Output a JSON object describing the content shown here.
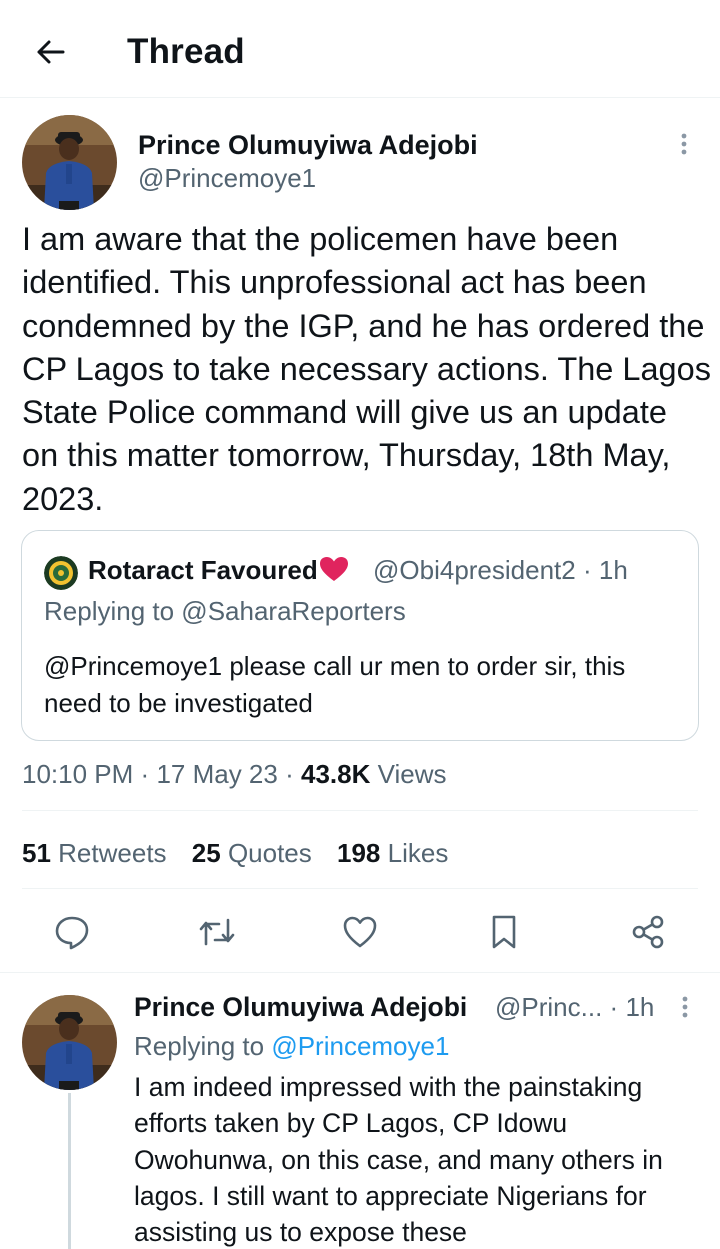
{
  "header": {
    "title": "Thread",
    "back_icon": "arrow-left-icon"
  },
  "main_tweet": {
    "author_name": "Prince Olumuyiwa Adejobi",
    "author_handle": "@Princemoye1",
    "text": "I am aware that the policemen have been identified. This unprofessional act has been condemned by the IGP, and he has ordered the CP Lagos to take necessary actions. The Lagos State Police command will give us an update on this matter tomorrow, Thursday, 18th May, 2023.",
    "quoted": {
      "author_name": "Rotaract Favoured",
      "author_handle": "@Obi4president2",
      "time": "1h",
      "replying_to": "Replying to @SaharaReporters",
      "text": "@Princemoye1 please call ur men to order sir, this need to be investigated"
    },
    "time": "10:10 PM",
    "date": "17 May 23",
    "views_count": "43.8K",
    "views_label": "Views",
    "stats": {
      "retweets_count": "51",
      "retweets_label": "Retweets",
      "quotes_count": "25",
      "quotes_label": "Quotes",
      "likes_count": "198",
      "likes_label": "Likes"
    },
    "actions": [
      "reply-icon",
      "retweet-icon",
      "like-icon",
      "bookmark-icon",
      "share-icon"
    ]
  },
  "reply_tweet": {
    "author_name": "Prince Olumuyiwa Adejobi",
    "author_handle_truncated": "@Princ...",
    "time": "1h",
    "replying_prefix": "Replying to",
    "replying_mention": "@Princemoye1",
    "text": "I am indeed impressed with the painstaking efforts taken by CP Lagos, CP Idowu Owohunwa, on this case, and many others in lagos. I still want to appreciate Nigerians for assisting us to expose these"
  },
  "colors": {
    "text": "#0f1419",
    "secondary": "#536471",
    "accent": "#1d9bf0",
    "divider": "#eff3f4",
    "uniform": "#2a4f9c",
    "heart": "#e0245e"
  }
}
